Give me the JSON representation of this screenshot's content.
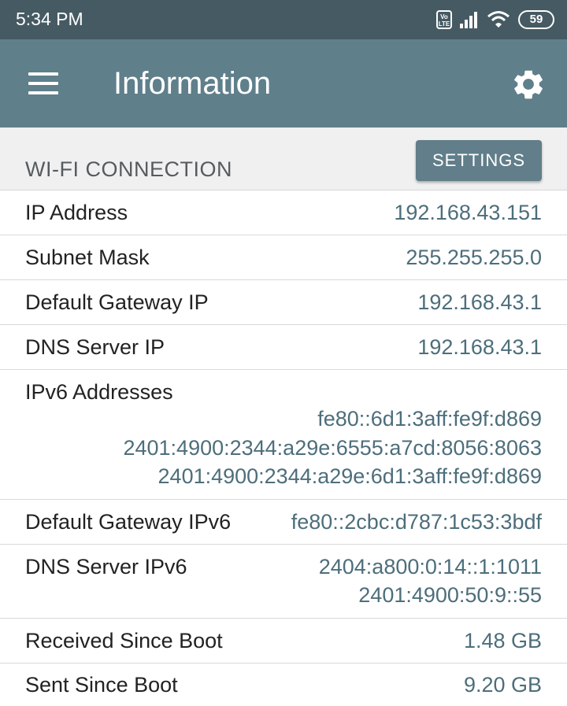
{
  "status_bar": {
    "time": "5:34 PM",
    "volte": "Vo LTE",
    "battery": "59"
  },
  "app_bar": {
    "title": "Information",
    "menu_icon": "hamburger-menu-icon",
    "settings_icon": "gear-icon"
  },
  "section": {
    "title": "WI-FI CONNECTION",
    "button_label": "SETTINGS"
  },
  "rows": [
    {
      "label": "IP Address",
      "values": [
        "192.168.43.151"
      ]
    },
    {
      "label": "Subnet Mask",
      "values": [
        "255.255.255.0"
      ]
    },
    {
      "label": "Default Gateway IP",
      "values": [
        "192.168.43.1"
      ]
    },
    {
      "label": "DNS Server IP",
      "values": [
        "192.168.43.1"
      ]
    },
    {
      "label": "IPv6 Addresses",
      "values": [
        "fe80::6d1:3aff:fe9f:d869",
        "2401:4900:2344:a29e:6555:a7cd:8056:8063",
        "2401:4900:2344:a29e:6d1:3aff:fe9f:d869"
      ]
    },
    {
      "label": "Default Gateway IPv6",
      "values": [
        "fe80::2cbc:d787:1c53:3bdf"
      ]
    },
    {
      "label": "DNS Server IPv6",
      "values": [
        "2404:a800:0:14::1:1011",
        "2401:4900:50:9::55"
      ]
    },
    {
      "label": "Received Since Boot",
      "values": [
        "1.48 GB"
      ]
    },
    {
      "label": "Sent Since Boot",
      "values": [
        "9.20 GB"
      ]
    }
  ],
  "colors": {
    "status_bar": "#465a63",
    "app_bar": "#5f7f8b",
    "value_text": "#4d6e7b",
    "section_bg": "#f0f0f0"
  }
}
